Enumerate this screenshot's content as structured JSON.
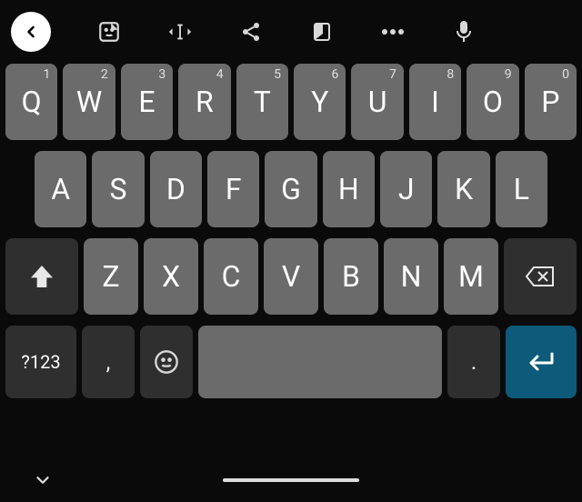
{
  "toolbar": {
    "back": "back",
    "sticker": "sticker",
    "cursor": "text-cursor",
    "share": "share",
    "onehand": "one-handed",
    "more": "more",
    "mic": "microphone"
  },
  "rows": {
    "row1": [
      {
        "label": "Q",
        "sup": "1"
      },
      {
        "label": "W",
        "sup": "2"
      },
      {
        "label": "E",
        "sup": "3"
      },
      {
        "label": "R",
        "sup": "4"
      },
      {
        "label": "T",
        "sup": "5"
      },
      {
        "label": "Y",
        "sup": "6"
      },
      {
        "label": "U",
        "sup": "7"
      },
      {
        "label": "I",
        "sup": "8"
      },
      {
        "label": "O",
        "sup": "9"
      },
      {
        "label": "P",
        "sup": "0"
      }
    ],
    "row2": [
      {
        "label": "A"
      },
      {
        "label": "S"
      },
      {
        "label": "D"
      },
      {
        "label": "F"
      },
      {
        "label": "G"
      },
      {
        "label": "H"
      },
      {
        "label": "J"
      },
      {
        "label": "K"
      },
      {
        "label": "L"
      }
    ],
    "row3": [
      {
        "label": "Z"
      },
      {
        "label": "X"
      },
      {
        "label": "C"
      },
      {
        "label": "V"
      },
      {
        "label": "B"
      },
      {
        "label": "N"
      },
      {
        "label": "M"
      }
    ],
    "symbols": {
      "sym_mode": "?123",
      "comma": ",",
      "period": "."
    }
  }
}
